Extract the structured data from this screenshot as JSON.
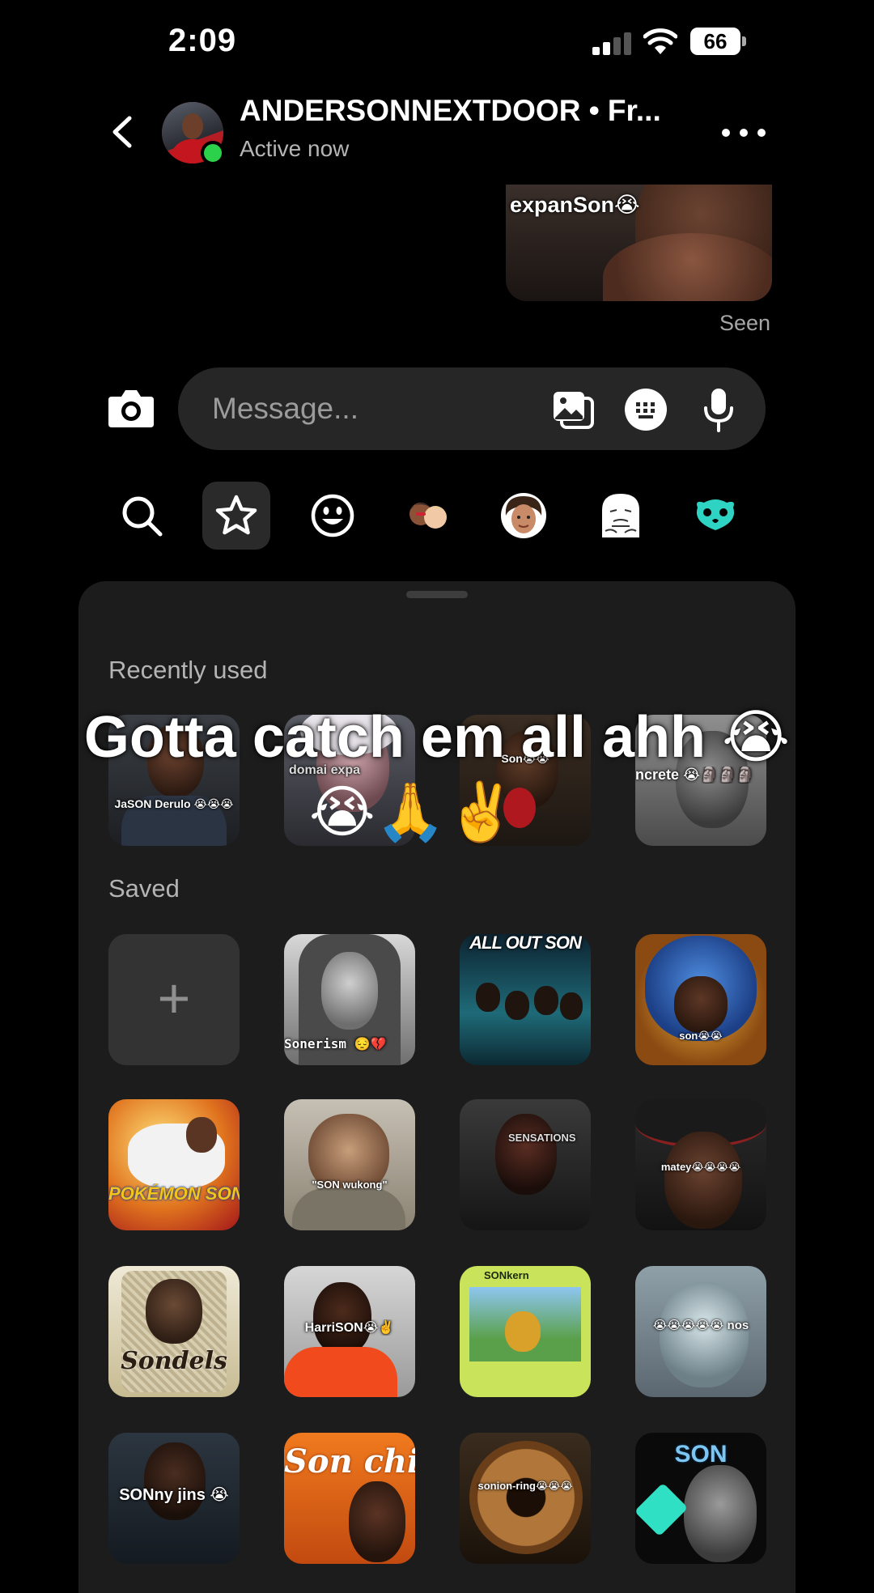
{
  "status_bar": {
    "time": "2:09",
    "battery": "66"
  },
  "header": {
    "contact_name": "ANDERSONNEXTDOOR • Fr...",
    "contact_status": "Active now"
  },
  "chat": {
    "last_sticker_caption": "expanSon😭",
    "seen_label": "Seen"
  },
  "composer": {
    "placeholder": "Message..."
  },
  "sticker_tabs": [
    {
      "icon": "search-icon"
    },
    {
      "icon": "star-icon",
      "active": true
    },
    {
      "icon": "smiley-icon"
    },
    {
      "icon": "avatar-pair-icon"
    },
    {
      "icon": "avatar-icon"
    },
    {
      "icon": "ghost-icon"
    },
    {
      "icon": "creature-icon"
    }
  ],
  "panel": {
    "recent_label": "Recently used",
    "saved_label": "Saved",
    "recent": [
      {
        "caption": "JaSON Derulo 😭😭😭"
      },
      {
        "caption": "domai expa"
      },
      {
        "caption": "Son😭😭"
      },
      {
        "caption": "ncrete 😭🗿🗿🗿"
      }
    ],
    "saved": [
      {
        "caption": "+"
      },
      {
        "caption": "Sonerism 😔💔"
      },
      {
        "caption": "ALL OUT SON"
      },
      {
        "caption": "son😭😭"
      },
      {
        "caption": "POKÉMON SON😭"
      },
      {
        "caption": "\"SON wukong\""
      },
      {
        "caption": "SENSATIONS"
      },
      {
        "caption": "matey😭😭😭😭"
      },
      {
        "caption": "Sondels"
      },
      {
        "caption": "HarriSON😭✌️"
      },
      {
        "caption": "SONkern"
      },
      {
        "caption": "😭😭😭😭😭 nos"
      },
      {
        "caption": "SONny jins 😭"
      },
      {
        "caption": "Son chips"
      },
      {
        "caption": "sonion-ring😭😭😭"
      },
      {
        "caption": "SON"
      }
    ]
  },
  "overlay": {
    "caption": "Gotta catch em all ahh 😭",
    "emoji_line": "😭🙏✌️"
  },
  "colors": {
    "online": "#2bd04b",
    "background": "#000000",
    "panel": "#1c1c1c",
    "input": "#262626"
  }
}
